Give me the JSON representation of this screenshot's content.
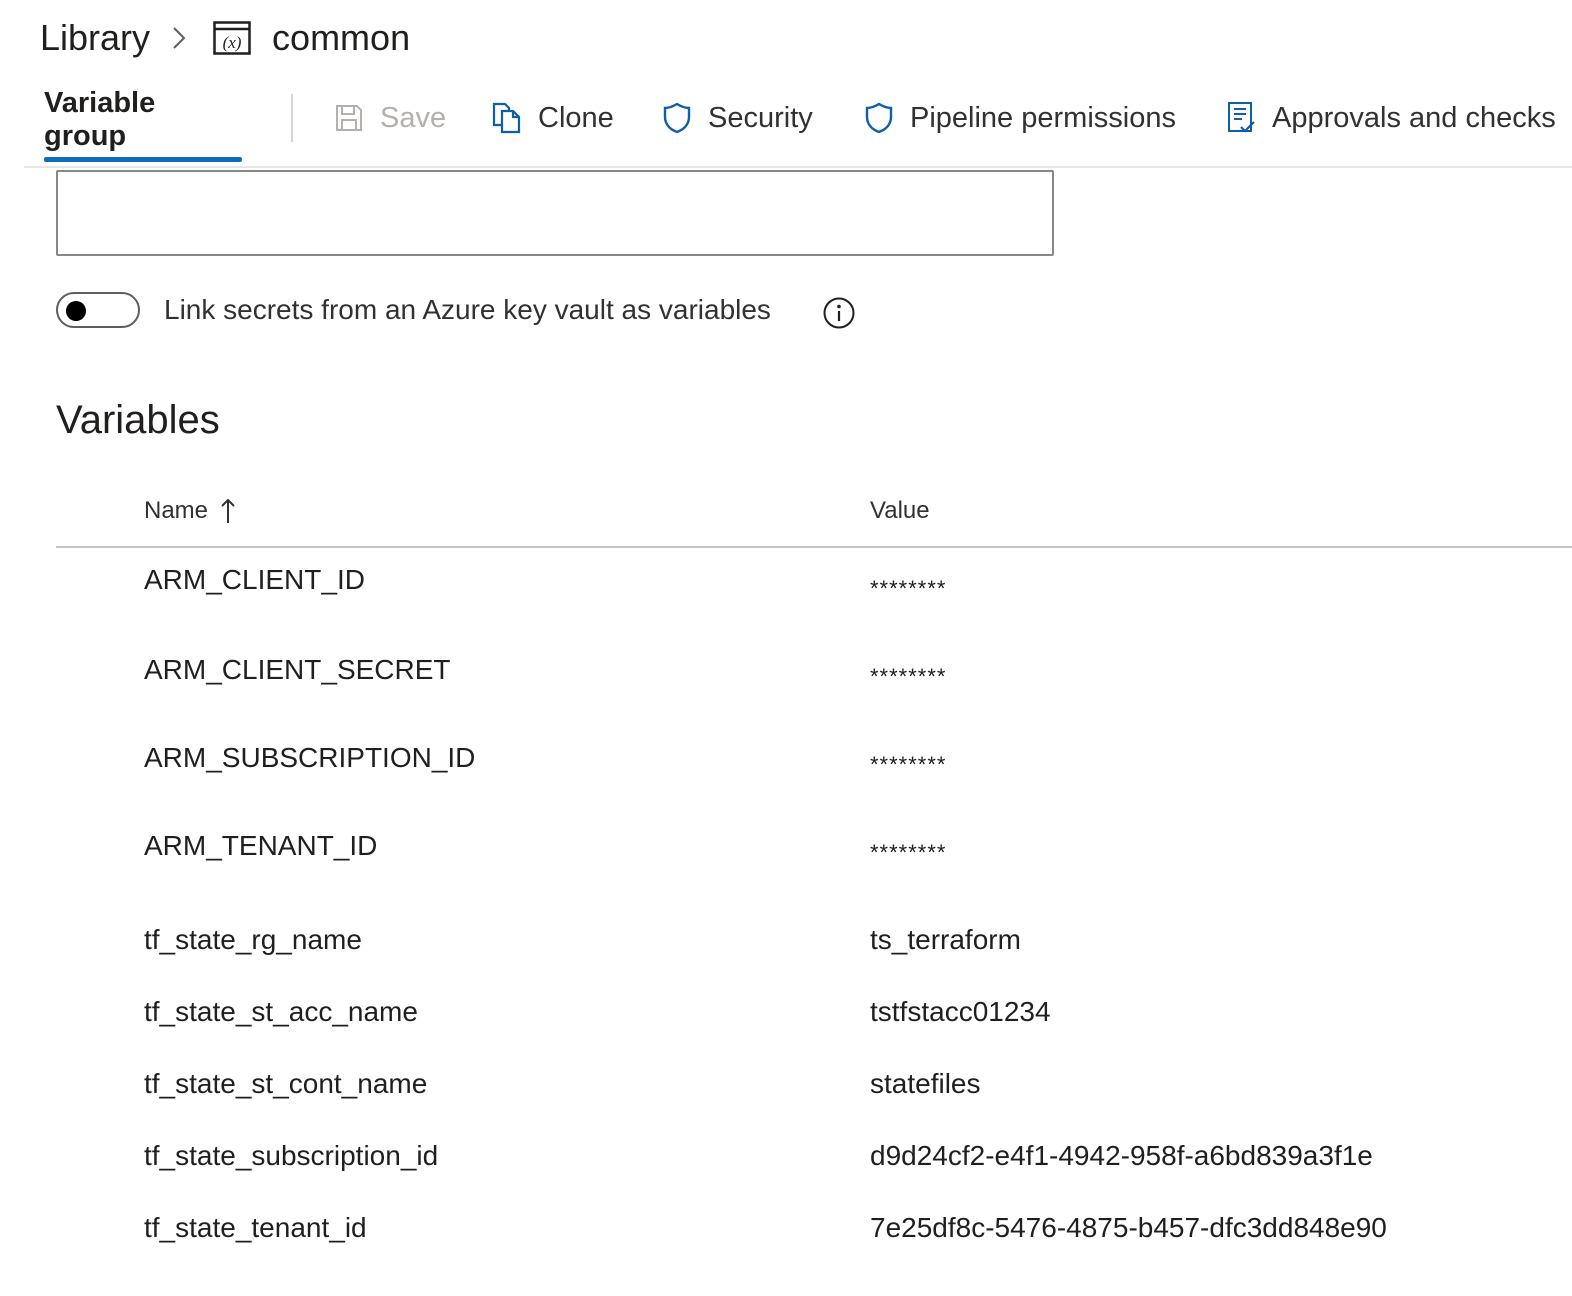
{
  "breadcrumb": {
    "library": "Library",
    "group_name": "common",
    "separator_icon": "chevron-right-icon",
    "group_icon": "variable-group-icon"
  },
  "toolbar": {
    "active_tab": "Variable group",
    "save_label": "Save",
    "clone_label": "Clone",
    "security_label": "Security",
    "pipeline_permissions_label": "Pipeline permissions",
    "approvals_label": "Approvals and checks",
    "accent_color": "#0f6cbd"
  },
  "keyvault": {
    "toggle_label": "Link secrets from an Azure key vault as variables",
    "toggle_on": false
  },
  "variables": {
    "title": "Variables",
    "columns": {
      "name": "Name",
      "value": "Value"
    },
    "rows": [
      {
        "name": "ARM_CLIENT_ID",
        "value": "********"
      },
      {
        "name": "ARM_CLIENT_SECRET",
        "value": "********"
      },
      {
        "name": "ARM_SUBSCRIPTION_ID",
        "value": "********"
      },
      {
        "name": "ARM_TENANT_ID",
        "value": "********"
      },
      {
        "name": "tf_state_rg_name",
        "value": "ts_terraform"
      },
      {
        "name": "tf_state_st_acc_name",
        "value": "tstfstacc01234"
      },
      {
        "name": "tf_state_st_cont_name",
        "value": "statefiles"
      },
      {
        "name": "tf_state_subscription_id",
        "value": "d9d24cf2-e4f1-4942-958f-a6bd839a3f1e"
      },
      {
        "name": "tf_state_tenant_id",
        "value": "7e25df8c-5476-4875-b457-dfc3dd848e90"
      }
    ]
  }
}
